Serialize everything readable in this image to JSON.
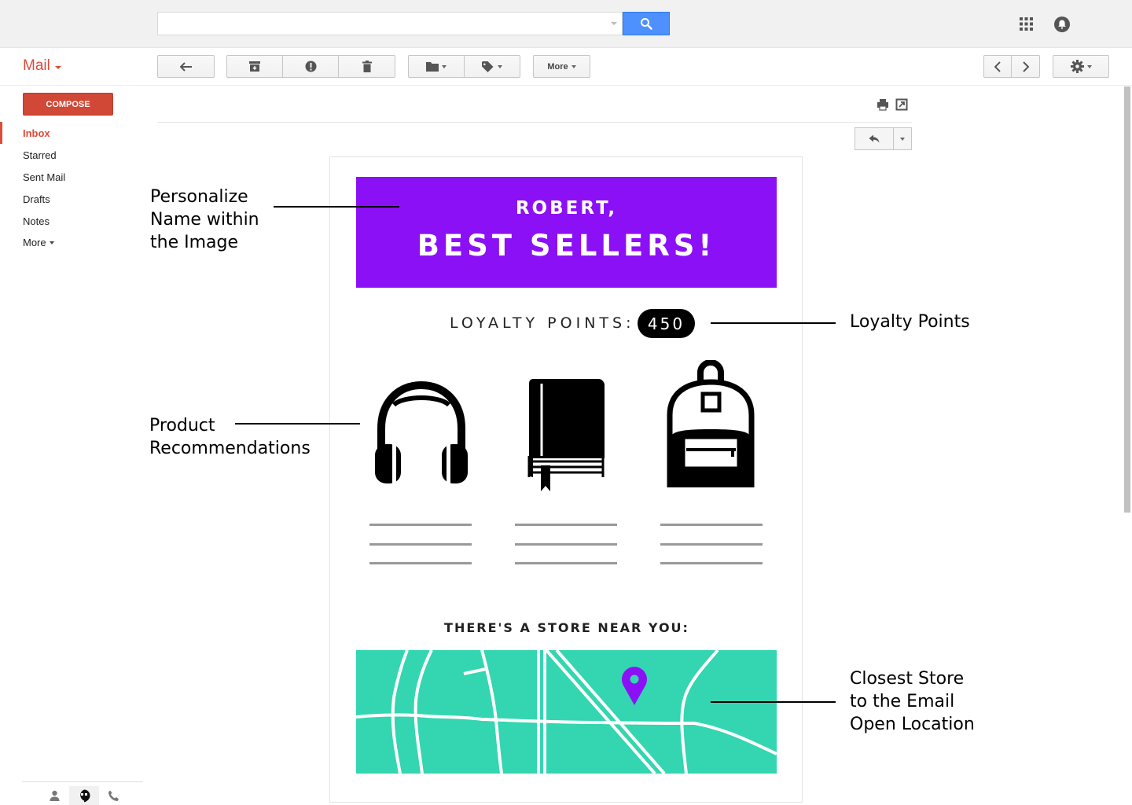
{
  "header": {
    "search": {
      "value": "",
      "placeholder": ""
    },
    "icons": [
      "apps-icon",
      "notifications-icon",
      "search-icon"
    ]
  },
  "mail_label": "Mail",
  "toolbar": {
    "more_label": "More",
    "buttons": [
      "back-arrow-icon",
      "archive-icon",
      "spam-icon",
      "delete-icon",
      "folder-icon",
      "label-icon",
      "prev-icon",
      "next-icon",
      "settings-icon"
    ]
  },
  "sidebar": {
    "compose_label": "COMPOSE",
    "items": [
      {
        "label": "Inbox",
        "active": true
      },
      {
        "label": "Starred",
        "active": false
      },
      {
        "label": "Sent Mail",
        "active": false
      },
      {
        "label": "Drafts",
        "active": false
      },
      {
        "label": "Notes",
        "active": false
      },
      {
        "label": "More",
        "active": false
      }
    ],
    "bottom_icons": [
      "contacts-icon",
      "hangouts-icon",
      "phone-icon"
    ]
  },
  "email": {
    "hero_name": "ROBERT,",
    "hero_headline": "BEST SELLERS!",
    "hero_color": "#8c10f5",
    "loyalty_label": "LOYALTY POINTS:",
    "loyalty_value": "450",
    "products": [
      "headphones-icon",
      "book-icon",
      "backpack-icon"
    ],
    "store_label": "THERE'S A STORE NEAR YOU:",
    "map_color": "#33d6b0",
    "pin_color": "#8c10f5"
  },
  "annotations": {
    "personalize": [
      "Personalize",
      "Name within",
      "the Image"
    ],
    "loyalty": "Loyalty Points",
    "products": [
      "Product",
      "Recommendations"
    ],
    "store": [
      "Closest Store",
      "to the Email",
      "Open Location"
    ]
  }
}
